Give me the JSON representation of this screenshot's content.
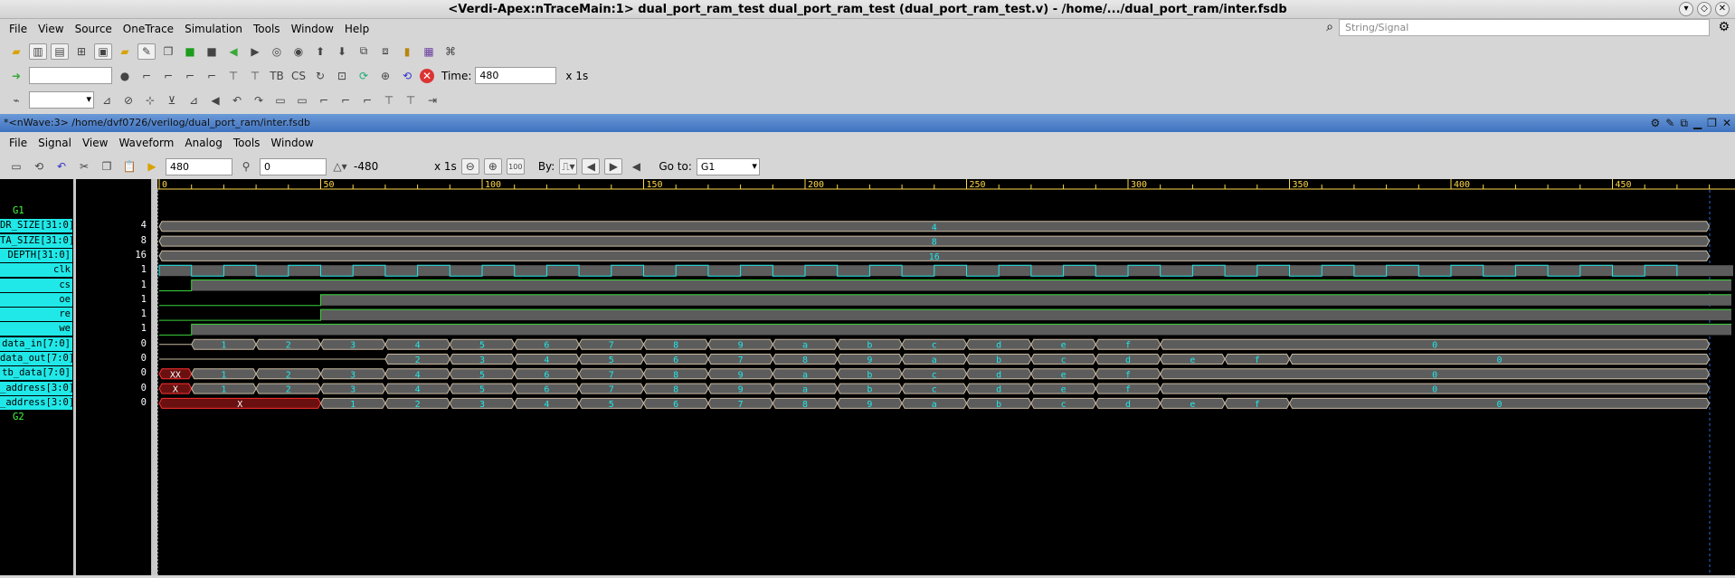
{
  "window": {
    "title": "<Verdi-Apex:nTraceMain:1> dual_port_ram_test dual_port_ram_test (dual_port_ram_test.v) - /home/.../dual_port_ram/inter.fsdb"
  },
  "main_menu": [
    "File",
    "View",
    "Source",
    "OneTrace",
    "Simulation",
    "Tools",
    "Window",
    "Help"
  ],
  "search": {
    "placeholder": "String/Signal"
  },
  "toolbar2": {
    "time_label": "Time:",
    "time_value": "480",
    "unit": "x 1s"
  },
  "nwave": {
    "title": "*<nWave:3> /home/dvf0726/verilog/dual_port_ram/inter.fsdb",
    "menu": [
      "File",
      "Signal",
      "View",
      "Waveform",
      "Analog",
      "Tools",
      "Window"
    ],
    "cursor": "480",
    "marker": "0",
    "delta": "-480",
    "unit": "x 1s",
    "by_label": "By:",
    "goto_label": "Go to:",
    "goto_value": "G1"
  },
  "ruler": {
    "ticks": [
      "0",
      "50",
      "100",
      "150",
      "200",
      "250",
      "300",
      "350",
      "400",
      "450"
    ]
  },
  "signals": [
    {
      "name": "G1",
      "group": true
    },
    {
      "name": "DR_SIZE[31:0]",
      "value": "4"
    },
    {
      "name": "TA_SIZE[31:0]",
      "value": "8"
    },
    {
      "name": "DEPTH[31:0]",
      "value": "16"
    },
    {
      "name": "clk",
      "value": "1"
    },
    {
      "name": "cs",
      "value": "1"
    },
    {
      "name": "oe",
      "value": "1"
    },
    {
      "name": "re",
      "value": "1"
    },
    {
      "name": "we",
      "value": "1"
    },
    {
      "name": "data_in[7:0]",
      "value": "0"
    },
    {
      "name": "data_out[7:0]",
      "value": "0"
    },
    {
      "name": "tb_data[7:0]",
      "value": "0"
    },
    {
      "name": "_address[3:0]",
      "value": "0"
    },
    {
      "name": "_address[3:0]",
      "value": "0"
    },
    {
      "name": "G2",
      "group": true
    }
  ],
  "bus_labels": {
    "const": [
      "4",
      "8",
      "16"
    ],
    "data_in": [
      "1",
      "2",
      "3",
      "4",
      "5",
      "6",
      "7",
      "8",
      "9",
      "a",
      "b",
      "c",
      "d",
      "e",
      "f",
      "0"
    ],
    "data_out": [
      "2",
      "3",
      "4",
      "5",
      "6",
      "7",
      "8",
      "9",
      "a",
      "b",
      "c",
      "d",
      "e",
      "f",
      "0"
    ],
    "tb_data": [
      "XX",
      "1",
      "2",
      "3",
      "4",
      "5",
      "6",
      "7",
      "8",
      "9",
      "a",
      "b",
      "c",
      "d",
      "e",
      "f",
      "0"
    ],
    "waddr": [
      "X",
      "1",
      "2",
      "3",
      "4",
      "5",
      "6",
      "7",
      "8",
      "9",
      "a",
      "b",
      "c",
      "d",
      "e",
      "f",
      "0"
    ],
    "raddr": [
      "X",
      "1",
      "2",
      "3",
      "4",
      "5",
      "6",
      "7",
      "8",
      "9",
      "a",
      "b",
      "c",
      "d",
      "e",
      "f",
      "0"
    ]
  },
  "colors": {
    "wave_bg": "#000000",
    "bus_fill": "#5c5c5c",
    "clk": "#21e8e8",
    "ctrl": "#39d439",
    "bus_text": "#21e8e8",
    "x_state": "#e02020",
    "ruler": "#ffd84a"
  }
}
